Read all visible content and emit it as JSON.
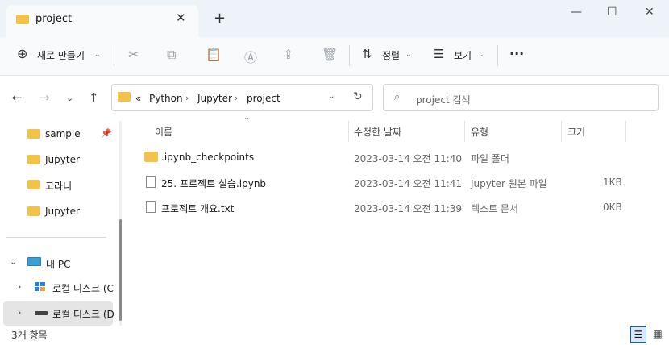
{
  "window": {
    "tab_title": "project",
    "tab_close": "✕",
    "new_tab": "+",
    "minimize": "—",
    "maximize": "☐",
    "close": "✕"
  },
  "toolbar": {
    "new_label": "새로 만들기",
    "sort_label": "정렬",
    "view_label": "보기",
    "more": "···"
  },
  "address": {
    "overflow": "«",
    "crumbs": [
      "Python",
      "Jupyter",
      "project"
    ],
    "separator": "›"
  },
  "search": {
    "placeholder": "project 검색"
  },
  "nav_pane": {
    "quick": [
      "sample",
      "Jupyter",
      "고라니",
      "Jupyter"
    ],
    "pc_label": "내 PC",
    "drives": [
      "로컬 디스크 (C",
      "로컬 디스크 (D"
    ]
  },
  "columns": {
    "name": "이름",
    "modified": "수정한 날짜",
    "type": "유형",
    "size": "크기"
  },
  "files": [
    {
      "name": ".ipynb_checkpoints",
      "modified": "2023-03-14 오전 11:40",
      "type": "파일 폴더",
      "size": ""
    },
    {
      "name": "25. 프로젝트 실습.ipynb",
      "modified": "2023-03-14 오전 11:41",
      "type": "Jupyter 원본 파일",
      "size": "1KB"
    },
    {
      "name": "프로젝트 개요.txt",
      "modified": "2023-03-14 오전 11:39",
      "type": "텍스트 문서",
      "size": "0KB"
    }
  ],
  "status": {
    "count": "3개 항목"
  },
  "colors": {
    "folder": "#f2c24b",
    "accent": "#0067c0",
    "tabstrip": "#eef3f9"
  }
}
